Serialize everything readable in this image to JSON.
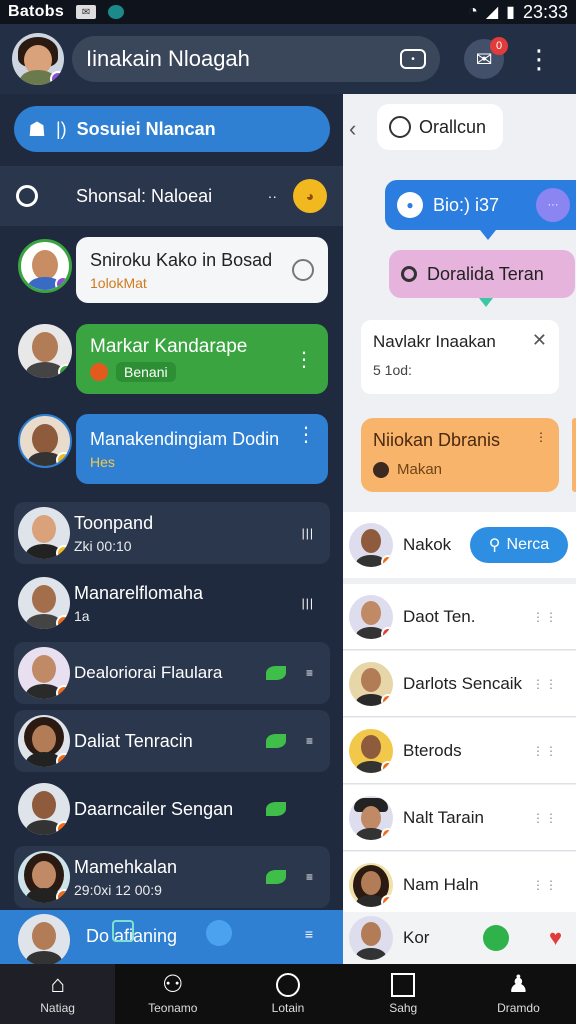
{
  "status_bar": {
    "label": "Batobs",
    "time": "23:33"
  },
  "top_bar": {
    "title": "Iinakain Nloagah",
    "mail_badge": "0"
  },
  "left": {
    "primary": {
      "label": "Sosuiei Nlancan",
      "sep": "|)"
    },
    "search": {
      "label": "Shonsal: Naloeai"
    },
    "cards": [
      {
        "name": "Sniroku Kako",
        "extra": "in Bosad",
        "sub": "1olokMat"
      },
      {
        "name": "Markar Kandarape",
        "sub": "Benani"
      },
      {
        "name": "Manakendingiam Dodin",
        "sub": "Hes"
      }
    ],
    "chats": [
      {
        "name": "Toonpand",
        "sub": "Zki 00:10"
      },
      {
        "name": "Manarelflomaha",
        "sub": "1a"
      },
      {
        "name": "Dealoriorai Flaulara",
        "sub": ""
      },
      {
        "name": "Daliat Tenracin",
        "sub": ""
      },
      {
        "name": "Daarncailer Sengan",
        "sub": ""
      },
      {
        "name": "Mamehkalan",
        "sub": "29:0xi 12 00:9"
      },
      {
        "name": "Do afianing",
        "sub": ""
      }
    ]
  },
  "right": {
    "top_pill": "Orallcun",
    "blue": "Bio:) i37",
    "pink": "Doralida Teran",
    "notif": {
      "title": "Navlakr Inaakan",
      "sub": "5 1od:"
    },
    "orange": {
      "title": "Niiokan Dbranis",
      "sub": "Makan"
    },
    "contact": {
      "name": "Nakok",
      "button": "Nerca"
    },
    "list": [
      {
        "name": "Daot Ten."
      },
      {
        "name": "Darlots Sencaik"
      },
      {
        "name": "Bterods"
      },
      {
        "name": "Nalt Tarain"
      },
      {
        "name": "Nam Haln"
      },
      {
        "name": "Kor"
      }
    ]
  },
  "bottom_nav": [
    {
      "label": "Natiag",
      "icon": "home-icon"
    },
    {
      "label": "Teonamo",
      "icon": "people-icon"
    },
    {
      "label": "Lotain",
      "icon": "circle-icon"
    },
    {
      "label": "Sahg",
      "icon": "square-icon"
    },
    {
      "label": "Dramdo",
      "icon": "person-icon"
    }
  ],
  "colors": {
    "background": "#1f2a3f",
    "primary_blue": "#2f7fd3",
    "green_card": "#3aa540",
    "orange_card": "#f8b46a",
    "pink_card": "#e5b3dc"
  }
}
